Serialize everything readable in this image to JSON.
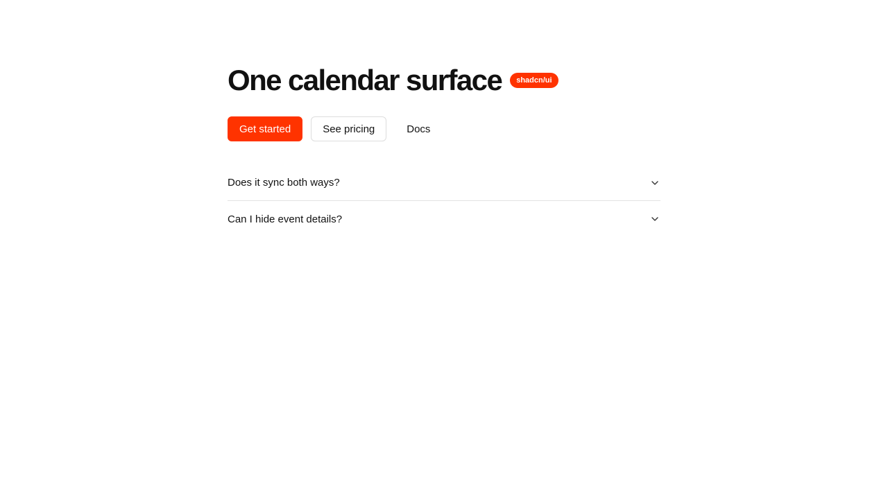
{
  "hero": {
    "title": "One calendar surface",
    "badge": "shadcn/ui"
  },
  "actions": {
    "primary_label": "Get started",
    "secondary_label": "See pricing",
    "tertiary_label": "Docs"
  },
  "faq": {
    "items": [
      {
        "question": "Does it sync both ways?"
      },
      {
        "question": "Can I hide event details?"
      }
    ]
  },
  "colors": {
    "accent": "#ff3300",
    "text": "#111111",
    "border": "#dddddd",
    "background": "#ffffff"
  },
  "icons": {
    "faq_toggle": "chevron-down-icon"
  }
}
